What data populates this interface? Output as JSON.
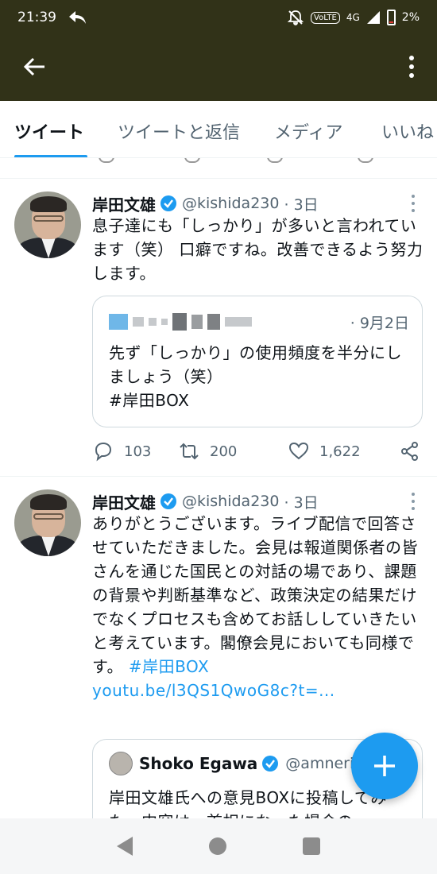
{
  "status_bar": {
    "time": "21:39",
    "battery": "2%",
    "network": "4G",
    "volte": "VoLTE"
  },
  "tabs": [
    {
      "label": "ツイート",
      "active": true
    },
    {
      "label": "ツイートと返信",
      "active": false
    },
    {
      "label": "メディア",
      "active": false
    },
    {
      "label": "いいね",
      "active": false
    }
  ],
  "tweets": [
    {
      "name": "岸田文雄",
      "handle": "@kishida230",
      "time": "· 3日",
      "text": "息子達にも「しっかり」が多いと言われています（笑） 口癖ですね。改善できるよう努力します。",
      "quote": {
        "time": "· 9月2日",
        "text_main": "先ず「しっかり」の使用頻度を半分にしましょう（笑）",
        "hashtag": "#岸田BOX"
      },
      "replies": "103",
      "retweets": "200",
      "likes": "1,622"
    },
    {
      "name": "岸田文雄",
      "handle": "@kishida230",
      "time": "· 3日",
      "text": "ありがとうございます。ライブ配信で回答させていただきました。会見は報道関係者の皆さんを通じた国民との対話の場であり、課題の背景や判断基準など、政策決定の結果だけでなくプロセスも含めてお話ししていきたいと考えています。閣僚会見においても同様です。",
      "hashtag": "#岸田BOX",
      "link": "youtu.be/l3QS1QwoG8c?t=...",
      "quote": {
        "name": "Shoko Egawa",
        "handle": "@amneri...",
        "text": "岸田文雄氏への意見BOXに投稿してみた。内容は、首相になった場合の"
      }
    }
  ],
  "colors": {
    "appbar": "#313218",
    "accent": "#1d9bf0",
    "muted": "#536471"
  },
  "icons": [
    "back-arrow-icon",
    "more-vert-icon",
    "verified-icon",
    "reply-icon",
    "retweet-icon",
    "like-icon",
    "share-icon",
    "compose-plus-icon"
  ]
}
